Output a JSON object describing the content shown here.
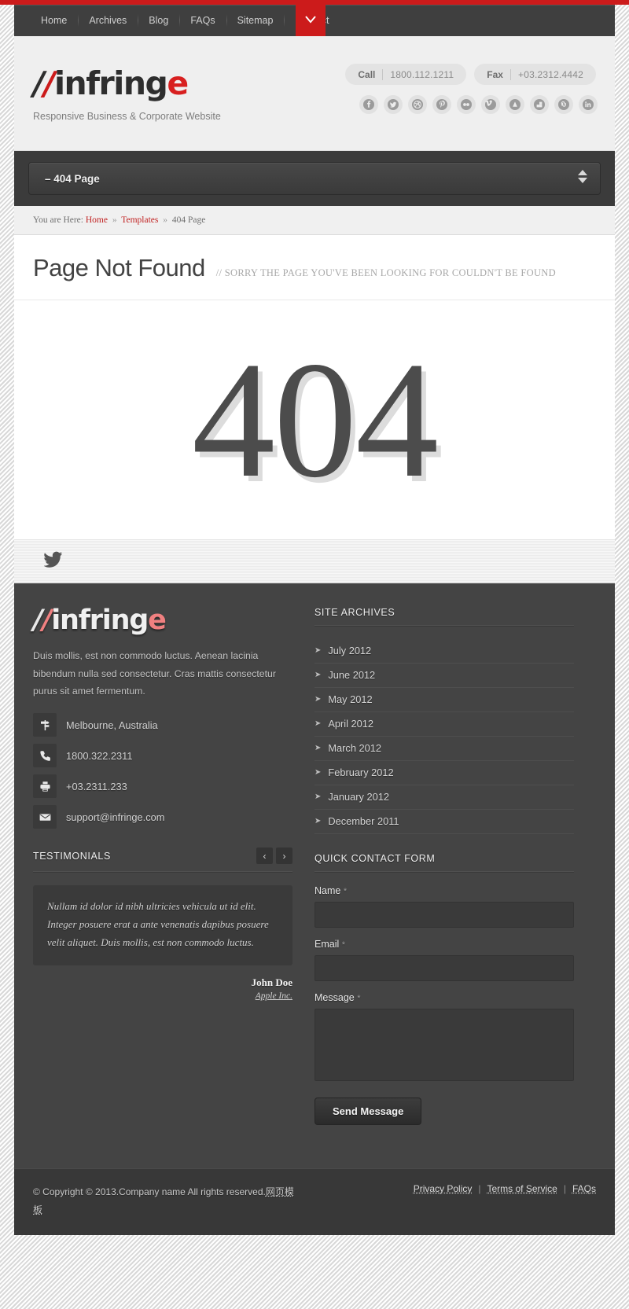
{
  "topnav": {
    "items": [
      {
        "label": "Home"
      },
      {
        "label": "Archives"
      },
      {
        "label": "Blog"
      },
      {
        "label": "FAQs"
      },
      {
        "label": "Sitemap"
      },
      {
        "label": "Contact"
      }
    ],
    "toggle_icon": "chevron-down-icon"
  },
  "header": {
    "logo": {
      "slash1": "/",
      "slash2": "/",
      "word": "infring",
      "word_accent": "e"
    },
    "tagline": "Responsive Business & Corporate Website",
    "call": {
      "label": "Call",
      "value": "1800.112.1211"
    },
    "fax": {
      "label": "Fax",
      "value": "+03.2312.4442"
    },
    "social": [
      {
        "name": "facebook-icon",
        "glyph": "f"
      },
      {
        "name": "twitter-icon",
        "glyph": "t"
      },
      {
        "name": "dribbble-icon",
        "glyph": "d"
      },
      {
        "name": "pinterest-icon",
        "glyph": "p"
      },
      {
        "name": "flickr-icon",
        "glyph": "fl"
      },
      {
        "name": "vimeo-icon",
        "glyph": "v"
      },
      {
        "name": "behance-icon",
        "glyph": "b"
      },
      {
        "name": "delicious-icon",
        "glyph": "de"
      },
      {
        "name": "stumbleupon-icon",
        "glyph": "su"
      },
      {
        "name": "linkedin-icon",
        "glyph": "in"
      }
    ]
  },
  "page_selector": {
    "selected": "–  404 Page"
  },
  "breadcrumb": {
    "prefix": "You are Here:",
    "home": "Home",
    "sep": "»",
    "section": "Templates",
    "current": "404 Page"
  },
  "page": {
    "title": "Page Not Found",
    "subtitle": "// SORRY THE PAGE YOU'VE BEEN LOOKING FOR COULDN'T BE FOUND",
    "error_code": "404"
  },
  "tweet_strip": {
    "icon": "twitter-bird-icon"
  },
  "footer": {
    "logo": {
      "slash1": "/",
      "slash2": "/",
      "word": "infring",
      "word_accent": "e"
    },
    "description": "Duis mollis, est non commodo luctus. Aenean lacinia bibendum nulla sed consectetur. Cras mattis consectetur purus sit amet fermentum.",
    "contacts": [
      {
        "icon": "map-signpost-icon",
        "value": "Melbourne, Australia"
      },
      {
        "icon": "phone-icon",
        "value": "1800.322.2311"
      },
      {
        "icon": "fax-printer-icon",
        "value": "+03.2311.233"
      },
      {
        "icon": "envelope-icon",
        "value": "support@infringe.com"
      }
    ],
    "archives": {
      "title": "SITE ARCHIVES",
      "items": [
        {
          "label": "July 2012"
        },
        {
          "label": "June 2012"
        },
        {
          "label": "May 2012"
        },
        {
          "label": "April 2012"
        },
        {
          "label": "March 2012"
        },
        {
          "label": "February 2012"
        },
        {
          "label": "January 2012"
        },
        {
          "label": "December 2011"
        }
      ]
    },
    "testimonials": {
      "title": "TESTIMONIALS",
      "prev": "‹",
      "next": "›",
      "quote": "Nullam id dolor id nibh ultricies vehicula ut id elit. Integer posuere erat a ante venenatis dapibus posuere velit aliquet. Duis mollis, est non commodo luctus.",
      "author": "John Doe",
      "company": "Apple Inc."
    },
    "contact_form": {
      "title": "QUICK CONTACT FORM",
      "name_label": "Name",
      "email_label": "Email",
      "message_label": "Message",
      "required_mark": "*",
      "name_value": "",
      "email_value": "",
      "message_value": "",
      "submit_label": "Send Message"
    }
  },
  "copyright": {
    "text_before": "© Copyright © 2013.Company name All rights reserved.",
    "cn_link": "网页模板",
    "links": [
      {
        "label": "Privacy Policy"
      },
      {
        "label": "Terms of Service"
      },
      {
        "label": "FAQs"
      }
    ],
    "separator": "|"
  },
  "colors": {
    "accent_red": "#cc1b1b",
    "nav_bg": "#3f3f3f",
    "footer_bg": "#444444",
    "header_bg": "#efefef",
    "footer_accent": "#f08080"
  }
}
